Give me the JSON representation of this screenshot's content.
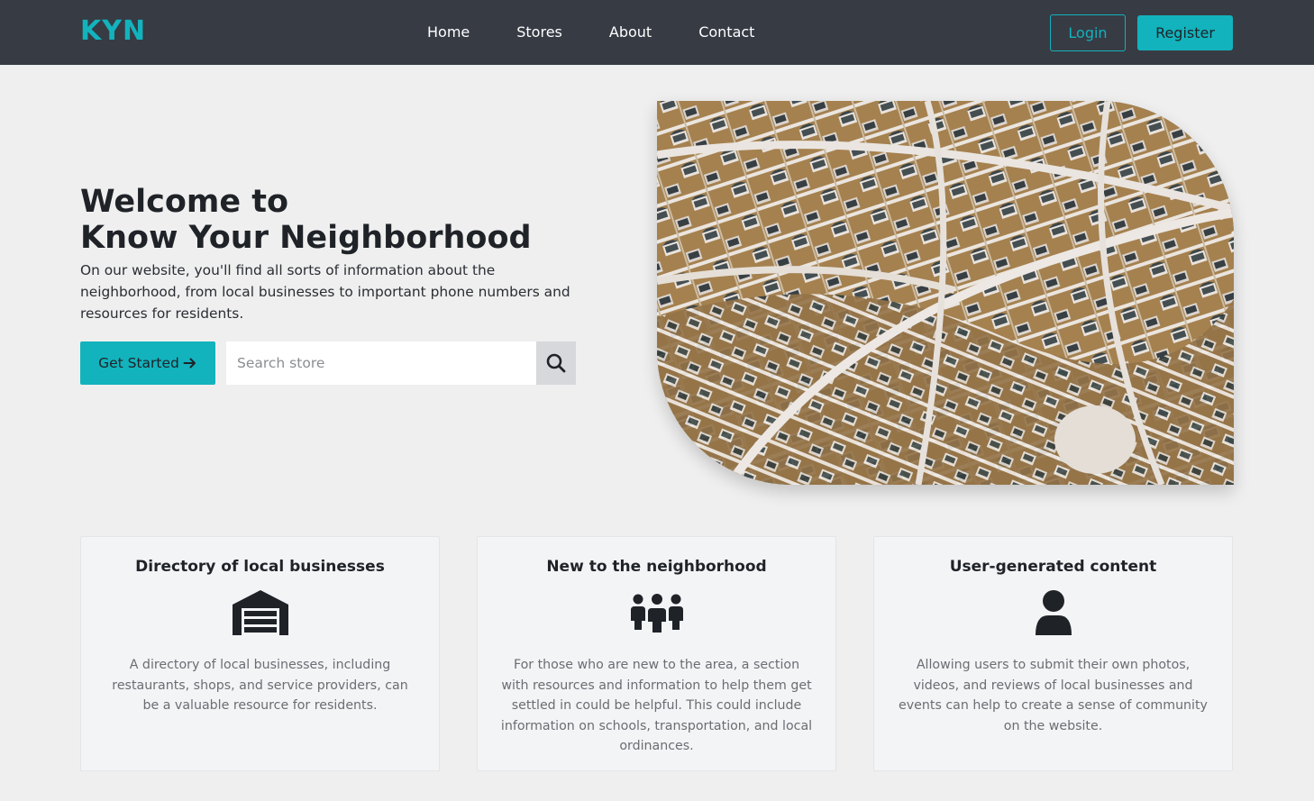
{
  "nav": {
    "brand": "KYN",
    "links": [
      "Home",
      "Stores",
      "About",
      "Contact"
    ],
    "login_label": "Login",
    "register_label": "Register"
  },
  "hero": {
    "title_line1": "Welcome to",
    "title_line2": "Know Your Neighborhood",
    "description": "On our website, you'll find all sorts of information about the neighborhood, from local businesses to important phone numbers and resources for residents.",
    "cta_label": "Get Started",
    "cta_icon": "arrow-right-icon",
    "search_placeholder": "Search store",
    "search_icon": "magnifier-icon"
  },
  "features": [
    {
      "title": "Directory of local businesses",
      "icon": "warehouse-icon",
      "text": "A directory of local businesses, including restaurants, shops, and service providers, can be a valuable resource for residents."
    },
    {
      "title": "New to the neighborhood",
      "icon": "people-group-icon",
      "text": "For those who are new to the area, a section with resources and information to help them get settled in could be helpful. This could include information on schools, transportation, and local ordinances."
    },
    {
      "title": "User-generated content",
      "icon": "user-icon",
      "text": "Allowing users to submit their own photos, videos, and reviews of local businesses and events can help to create a sense of community on the website."
    }
  ],
  "colors": {
    "accent": "#12b3bd",
    "navbar_bg": "#373b44",
    "page_bg": "#efefef",
    "card_bg": "#f3f4f6"
  }
}
